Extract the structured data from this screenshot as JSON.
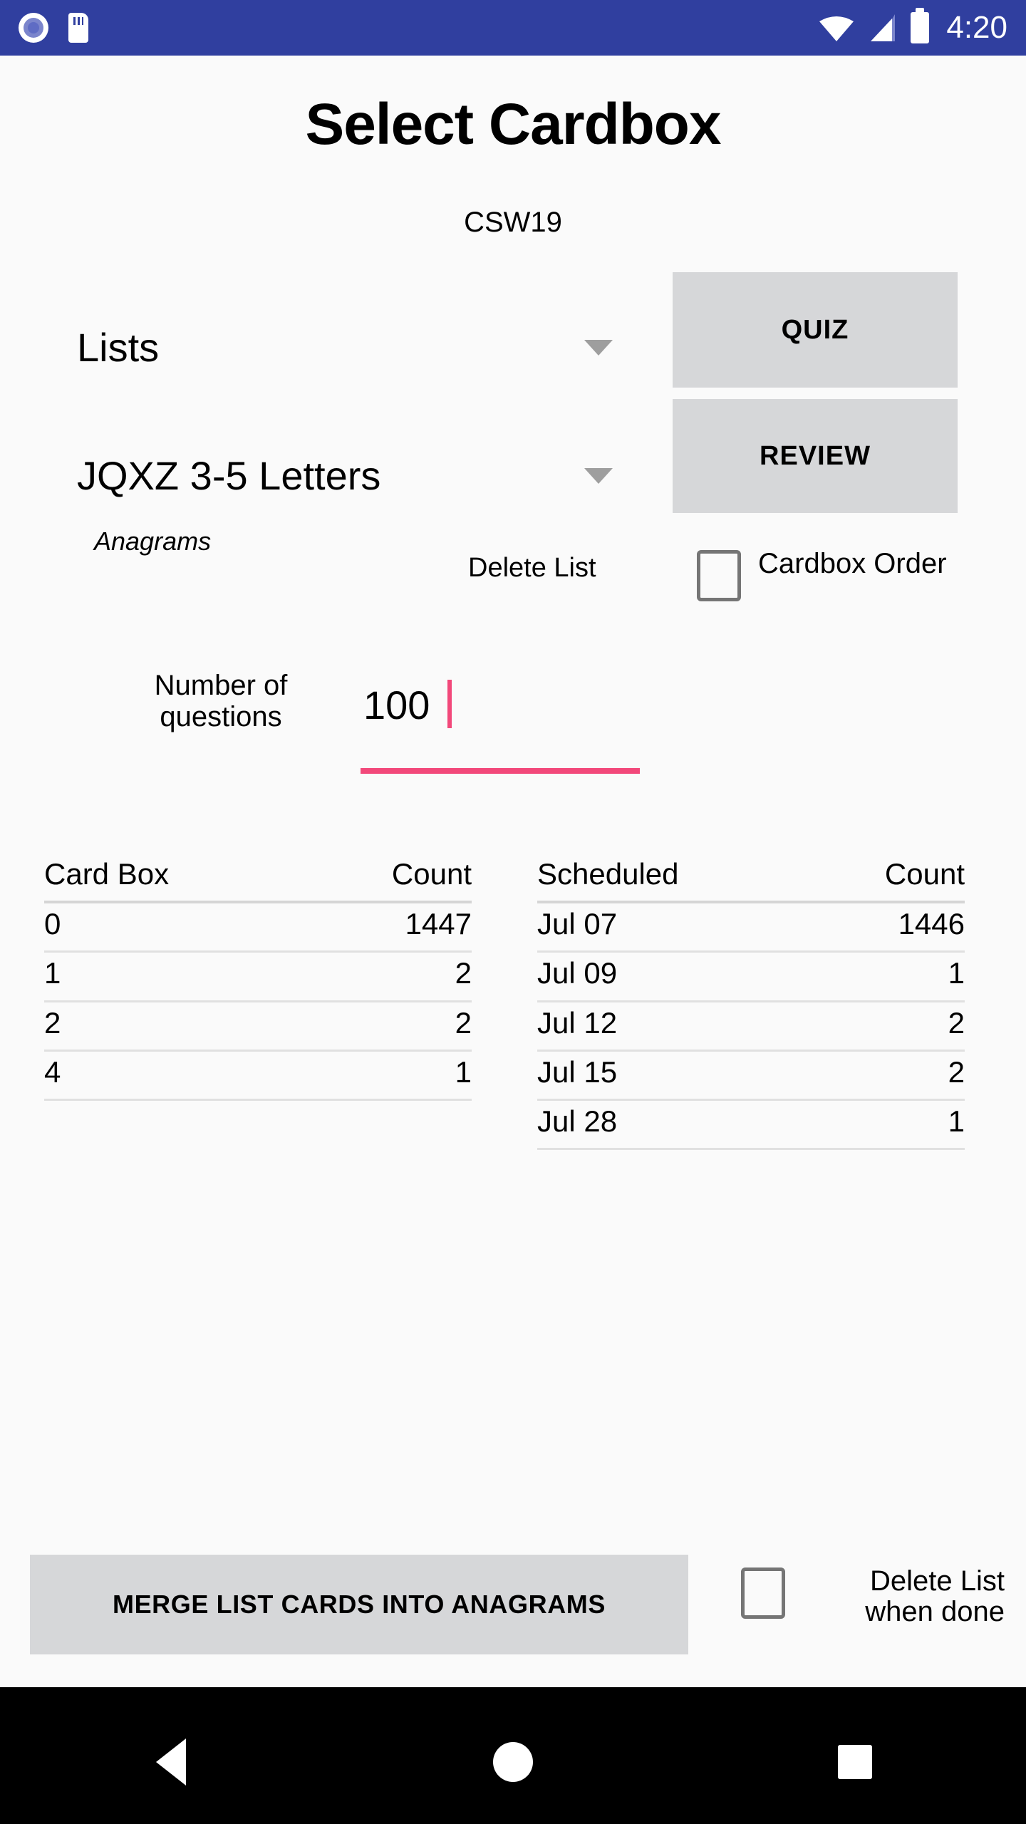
{
  "status_bar": {
    "background_color": "#303f9f",
    "time": "4:20",
    "icons": [
      "screen-record-icon",
      "sd-card-icon",
      "wifi-icon",
      "signal-icon",
      "battery-icon"
    ]
  },
  "header": {
    "title": "Select Cardbox",
    "subtitle": "CSW19"
  },
  "selectors": {
    "lists_spinner_value": "Lists",
    "list_name_spinner_value": "JQXZ 3-5 Letters",
    "anagrams_label": "Anagrams",
    "delete_list_label": "Delete List"
  },
  "actions": {
    "quiz_label": "QUIZ",
    "review_label": "REVIEW",
    "merge_label": "MERGE LIST CARDS INTO ANAGRAMS"
  },
  "checkboxes": {
    "cardbox_order_label": "Cardbox Order",
    "cardbox_order_checked": false,
    "delete_when_done_label": "Delete List when done",
    "delete_when_done_checked": false
  },
  "number_of_questions": {
    "label": "Number of questions",
    "value": "100",
    "accent_color": "#f2487a"
  },
  "tables": {
    "cardbox": {
      "headers": [
        "Card Box",
        "Count"
      ],
      "rows": [
        [
          "0",
          "1447"
        ],
        [
          "1",
          "2"
        ],
        [
          "2",
          "2"
        ],
        [
          "4",
          "1"
        ]
      ]
    },
    "scheduled": {
      "headers": [
        "Scheduled",
        "Count"
      ],
      "rows": [
        [
          "Jul 07",
          "1446"
        ],
        [
          "Jul 09",
          "1"
        ],
        [
          "Jul 12",
          "2"
        ],
        [
          "Jul 15",
          "2"
        ],
        [
          "Jul 28",
          "1"
        ]
      ]
    }
  },
  "nav_bar": {
    "background_color": "#000000",
    "items": [
      "back-icon",
      "home-icon",
      "recents-icon"
    ]
  }
}
